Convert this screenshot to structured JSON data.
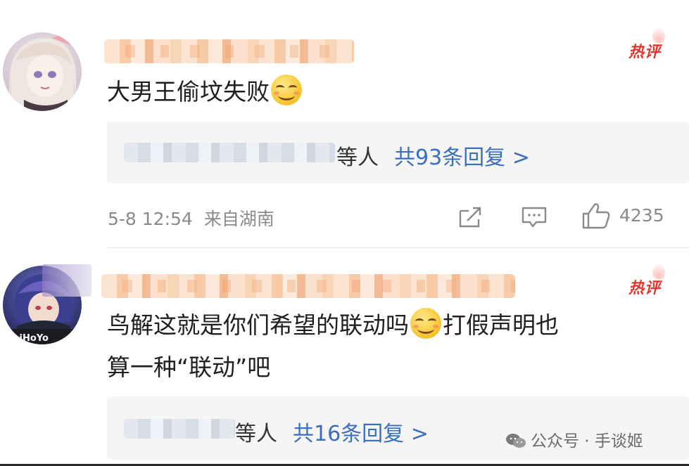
{
  "comments": [
    {
      "hot_label": "热评",
      "text": "大男王偷坟失败",
      "emoji": "smirk-emoji",
      "reply_summary": {
        "suffix": "等人",
        "link": "共93条回复 >"
      },
      "time": "5-8 12:54",
      "location": "来自湖南",
      "likes": "4235"
    },
    {
      "hot_label": "热评",
      "text_line1_a": "鸟解这就是你们希望的联动吗",
      "emoji": "grin-emoji",
      "text_line1_b": "打假声明也",
      "text_line2": "算一种“联动”吧",
      "avatar_text": "miHoYo",
      "reply_summary": {
        "suffix": "等人",
        "link": "共16条回复 >"
      }
    }
  ],
  "watermark": "公众号 · 手谈姬",
  "icons": {
    "share": "share-icon",
    "comment": "comment-icon",
    "like": "thumbs-up-icon",
    "wechat": "wechat-icon"
  },
  "colors": {
    "hot": "#e8322d",
    "link": "#3a6fbf",
    "meta": "#8a8a8a",
    "reply_bg": "#f5f5f5"
  }
}
